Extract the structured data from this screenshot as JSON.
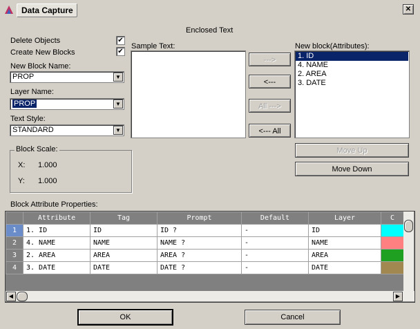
{
  "window": {
    "title": "Data Capture",
    "close_label": "✕"
  },
  "options": {
    "delete_objects": "Delete Objects",
    "create_new_blocks": "Create New Blocks",
    "delete_checked": "✔",
    "create_checked": "✔"
  },
  "fields": {
    "new_block_name_label": "New Block Name:",
    "new_block_name_value": "PROP",
    "layer_name_label": "Layer Name:",
    "layer_name_value": "PROP",
    "text_style_label": "Text Style:",
    "text_style_value": "STANDARD"
  },
  "block_scale": {
    "caption": "Block Scale:",
    "x_label": "X:",
    "x_value": "1.000",
    "y_label": "Y:",
    "y_value": "1.000"
  },
  "enclosed_text": {
    "heading": "Enclosed Text",
    "sample_label": "Sample Text:"
  },
  "transfer_buttons": {
    "add": "--->",
    "remove": "<---",
    "add_all": "All --->",
    "remove_all": "<--- All"
  },
  "new_block": {
    "label": "New block(Attributes):",
    "items": [
      "1.  ID",
      "4.  NAME",
      "2.  AREA",
      "3.  DATE"
    ],
    "move_up": "Move Up",
    "move_down": "Move Down"
  },
  "properties": {
    "label": "Block Attribute Properties:",
    "columns": [
      "Attribute",
      "Tag",
      "Prompt",
      "Default",
      "Layer",
      "C"
    ],
    "rows": [
      {
        "num": "1",
        "attribute": "1.  ID",
        "tag": "ID",
        "prompt": "ID ?",
        "default": "-",
        "layer": "ID",
        "color": "#00ffff"
      },
      {
        "num": "2",
        "attribute": "4.  NAME",
        "tag": "NAME",
        "prompt": "NAME ?",
        "default": "-",
        "layer": "NAME",
        "color": "#ff8080"
      },
      {
        "num": "3",
        "attribute": "2.  AREA",
        "tag": "AREA",
        "prompt": "AREA ?",
        "default": "-",
        "layer": "AREA",
        "color": "#20a020"
      },
      {
        "num": "4",
        "attribute": "3.  DATE",
        "tag": "DATE",
        "prompt": "DATE ?",
        "default": "-",
        "layer": "DATE",
        "color": "#a08850"
      }
    ]
  },
  "footer": {
    "ok": "OK",
    "cancel": "Cancel"
  }
}
